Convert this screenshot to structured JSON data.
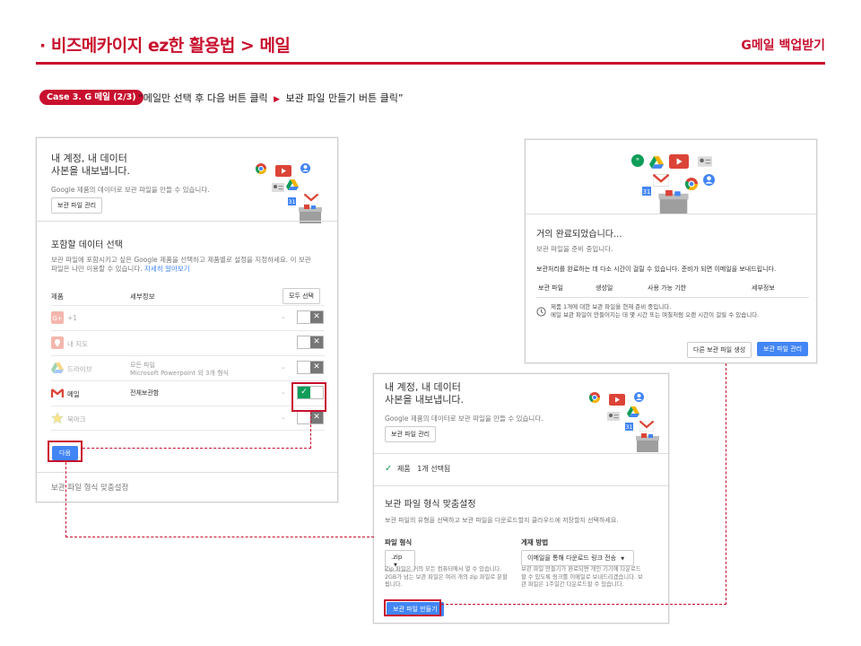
{
  "header": {
    "title": "· 비즈메카이지 ez한 활용법 > 메일",
    "subtitle": "G메일 백업받기"
  },
  "step": {
    "badge": "Case 3. G 메일 (2/3)",
    "desc_part1": "“메일만 선택 후 다음 버튼 클릭",
    "desc_part2": "보관 파일 만들기 버튼 클릭”"
  },
  "left_panel": {
    "heading_line1": "내 계정, 내 데이터",
    "heading_line2": "사본을 내보냅니다.",
    "intro": "Google 제품의 데이터로 보관 파일을 만들 수 있습니다.",
    "manage_button": "보관 파일 관리",
    "section_title": "포함할 데이터 선택",
    "section_desc_line1": "보관 파일에 포함시키고 싶은 Google 제품을 선택하고 제품별로 설정을 지정하세요. 이 보관",
    "section_desc_line2": "파일은 나만 이용할 수 있습니다.",
    "learn_more": "자세히 알아보기",
    "col_product": "제품",
    "col_detail": "세부정보",
    "select_all": "모두 선택",
    "products": [
      {
        "name": "+1",
        "detail1": "",
        "detail2": ""
      },
      {
        "name": "내 지도",
        "detail1": "",
        "detail2": ""
      },
      {
        "name": "드라이브",
        "detail1": "모든 파일",
        "detail2": "Microsoft Powerpoint 외 3개 형식"
      },
      {
        "name": "메일",
        "detail1": "전체보관함",
        "detail2": ""
      },
      {
        "name": "북마크",
        "detail1": "",
        "detail2": ""
      }
    ],
    "next_button": "다음",
    "footer_label": "보관 파일 형식 맞춤설정"
  },
  "right_panel": {
    "heading": "거의 완료되었습니다...",
    "preparing": "보관 파일을 준비 중입니다.",
    "notice": "보관처리를 완료하는 데 다소 시간이 걸릴 수 있습니다. 준비가 되면 이메일을 보내드립니다.",
    "col_file": "보관 파일",
    "col_created": "생성일",
    "col_expiry": "사용 가능 기한",
    "col_detail": "세부정보",
    "status_line1": "제품 1개에 대한 보관 파일을 현재 준비 중입니다.",
    "status_line2": "메일 보관 파일이 만들어지는 데 몇 시간 또는 며칠처럼 오랜 시간이 걸릴 수 있습니다.",
    "other_button": "다른 보관 파일 생성",
    "manage_button": "보관 파일 관리"
  },
  "bottom_panel": {
    "heading_line1": "내 계정, 내 데이터",
    "heading_line2": "사본을 내보냅니다.",
    "intro": "Google 제품의 데이터로 보관 파일을 만들 수 있습니다.",
    "manage_button": "보관 파일 관리",
    "selected_label": "제품",
    "selected_count": "1개 선택됨",
    "section_title": "보관 파일 형식 맞춤설정",
    "section_desc": "보관 파일의 유형을 선택하고 보관 파일을 다운로드할지 클라우드에 저장할지 선택하세요.",
    "format_label": "파일 형식",
    "format_value": ".zip",
    "format_help_line1": "Zip 파일은 거의 모든 컴퓨터에서 열 수 있습니다.",
    "format_help_line2": "2GB가 넘는 보관 파일은 여러 개의 zip 파일로 분할",
    "format_help_line3": "됩니다.",
    "delivery_label": "게재 방법",
    "delivery_value": "이메일을 통해 다운로드 링크 전송",
    "delivery_help_line1": "보관 파일 만들기가 완료되면 개인 기기에 다운로드",
    "delivery_help_line2": "할 수 있도록 링크를 이메일로 보내드리겠습니다. 보",
    "delivery_help_line3": "관 파일은 1주일간 다운로드할 수 있습니다.",
    "create_button": "보관 파일 만들기"
  },
  "colors": {
    "accent": "#c8102e",
    "google_blue": "#4285f4",
    "google_green": "#0f9d58"
  }
}
